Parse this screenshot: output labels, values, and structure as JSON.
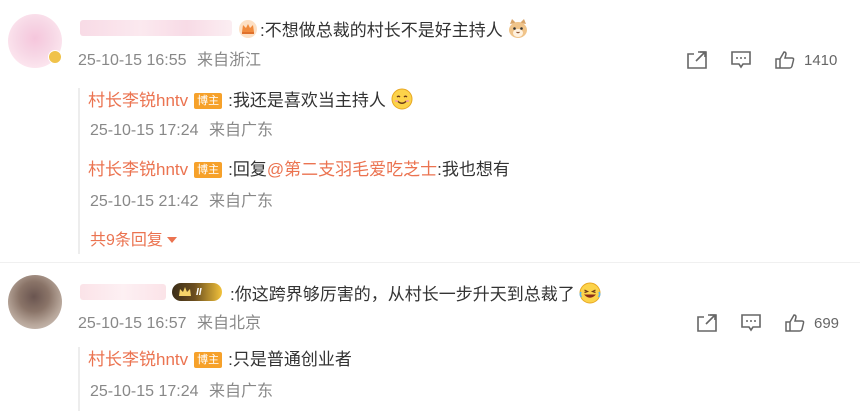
{
  "comments": [
    {
      "text": ":不想做总裁的村长不是好主持人",
      "time": "25-10-15 16:55",
      "location": "来自浙江",
      "likes": "1410",
      "replies": [
        {
          "author": "村长李锐hntv",
          "tag": "博主",
          "text": ":我还是喜欢当主持人",
          "time": "25-10-15 17:24",
          "location": "来自广东"
        },
        {
          "author": "村长李锐hntv",
          "tag": "博主",
          "text_prefix": ":回复",
          "mention": "@第二支羽毛爱吃芝士",
          "text_suffix": ":我也想有",
          "time": "25-10-15 21:42",
          "location": "来自广东"
        }
      ],
      "more_replies": "共9条回复"
    },
    {
      "text": ":你这跨界够厉害的，从村长一步升天到总裁了",
      "level_badge": "II",
      "time": "25-10-15 16:57",
      "location": "来自北京",
      "likes": "699",
      "replies": [
        {
          "author": "村长李锐hntv",
          "tag": "博主",
          "text": ":只是普通创业者",
          "time": "25-10-15 17:24",
          "location": "来自广东"
        }
      ]
    }
  ]
}
